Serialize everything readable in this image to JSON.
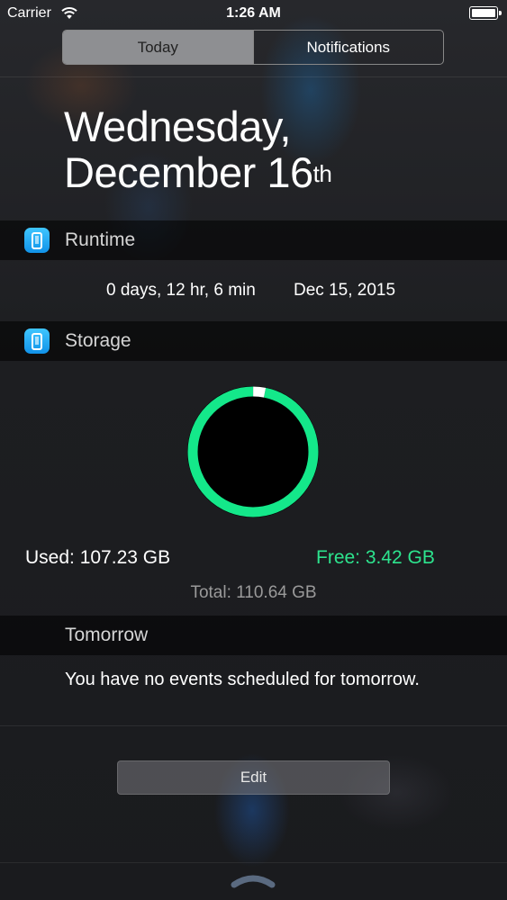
{
  "status_bar": {
    "carrier": "Carrier",
    "time": "1:26 AM",
    "icons": [
      "wifi-icon",
      "battery-icon"
    ]
  },
  "segmented_control": {
    "tabs": [
      {
        "label": "Today",
        "selected": true
      },
      {
        "label": "Notifications",
        "selected": false
      }
    ]
  },
  "date": {
    "line1": "Wednesday,",
    "line2": "December 16",
    "suffix": "th"
  },
  "runtime": {
    "title": "Runtime",
    "icon": "phone-app-icon",
    "duration": "0 days, 12 hr, 6 min",
    "date": "Dec 15, 2015"
  },
  "storage": {
    "title": "Storage",
    "icon": "phone-app-icon",
    "used_label": "Used: 107.23 GB",
    "free_label": "Free: 3.42 GB",
    "total_label": "Total: 110.64 GB",
    "used_gb": 107.23,
    "free_gb": 3.42,
    "total_gb": 110.64,
    "colors": {
      "used": "#14e88a",
      "free": "#ffffff",
      "free_text": "#2de48e"
    }
  },
  "tomorrow": {
    "title": "Tomorrow",
    "message": "You have no events scheduled for tomorrow."
  },
  "edit_label": "Edit",
  "colors": {
    "accent_green": "#14e88a",
    "app_icon_blue": "#1a9ff0"
  }
}
